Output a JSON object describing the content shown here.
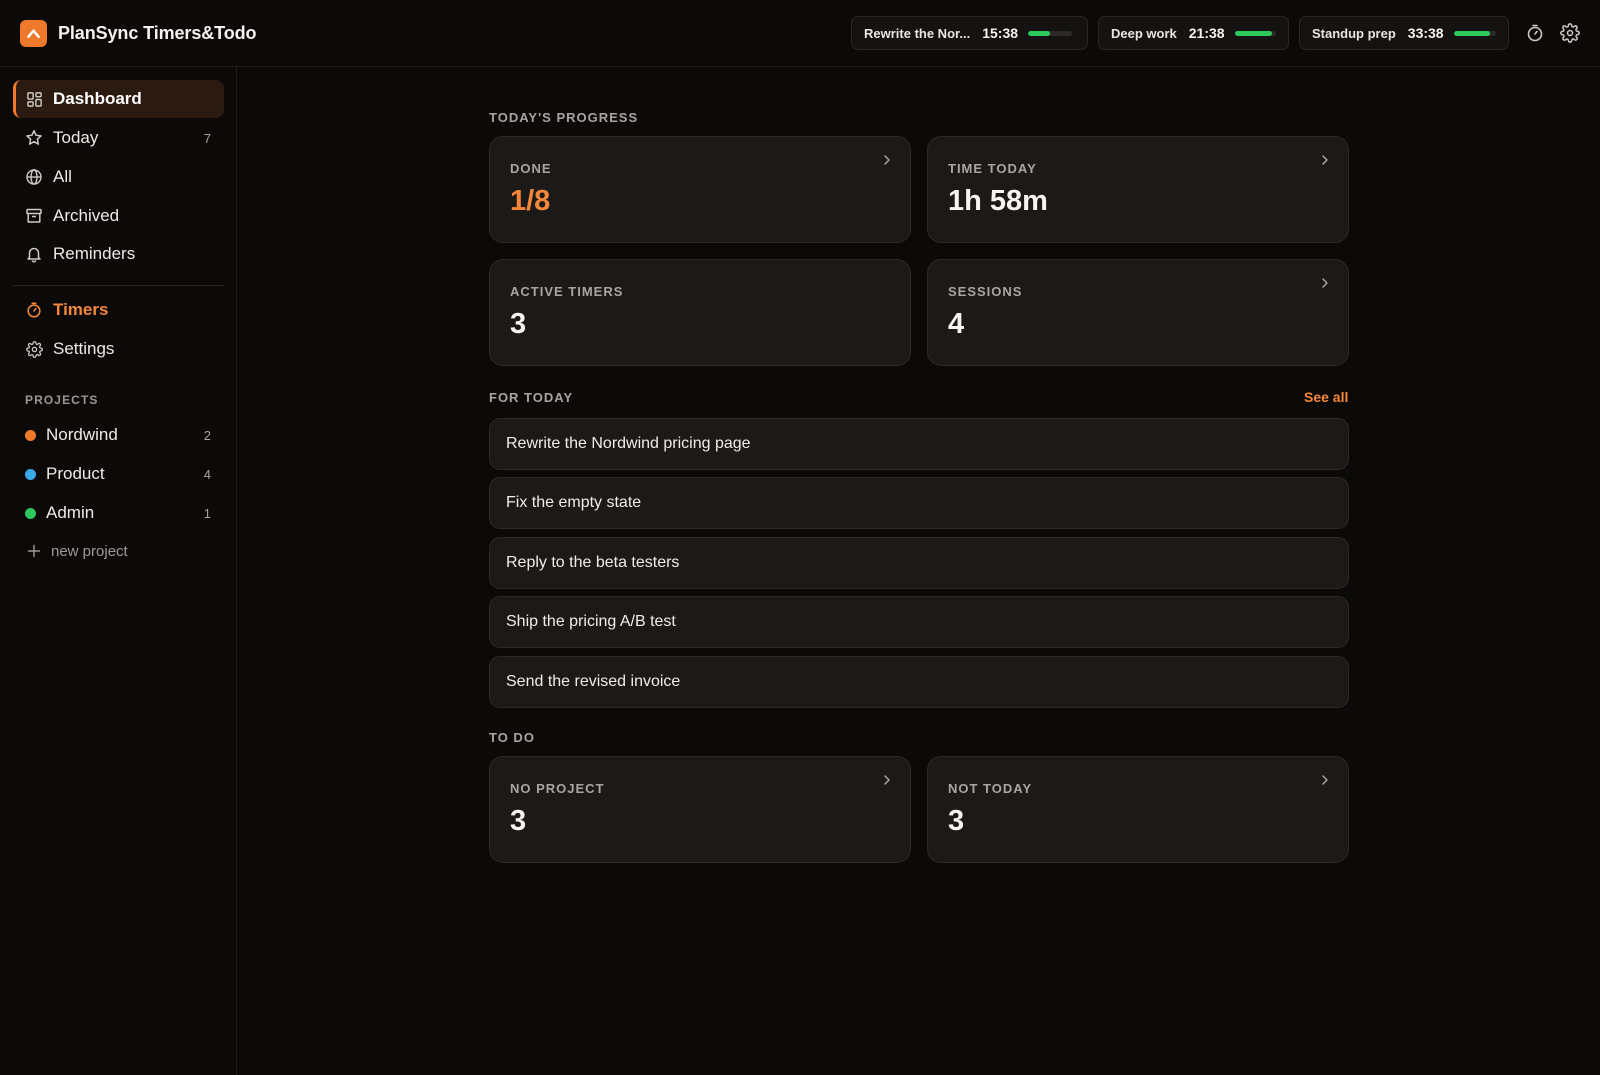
{
  "app": {
    "title": "PlanSync Timers&Todo",
    "accent_color": "#f07a2c",
    "logo_icon": "app-logo-icon"
  },
  "timers": [
    {
      "name": "Rewrite the Nor...",
      "time": "15:38",
      "progress": 0.5
    },
    {
      "name": "Deep work",
      "time": "21:38",
      "progress": 0.9
    },
    {
      "name": "Standup prep",
      "time": "33:38",
      "progress": 0.85
    }
  ],
  "topbar_icons": [
    "stopwatch-icon",
    "gear-icon"
  ],
  "sidebar": {
    "items": [
      {
        "label": "Dashboard",
        "icon": "dashboard-icon",
        "active": true
      },
      {
        "label": "Today",
        "icon": "star-icon",
        "count": "7"
      },
      {
        "label": "All",
        "icon": "globe-icon"
      },
      {
        "label": "Archived",
        "icon": "archive-icon"
      },
      {
        "label": "Reminders",
        "icon": "bell-icon"
      }
    ],
    "secondary": [
      {
        "label": "Timers",
        "icon": "stopwatch-icon",
        "color": "#f5873a"
      },
      {
        "label": "Settings",
        "icon": "gear-icon"
      }
    ],
    "projects_label": "PROJECTS",
    "projects": [
      {
        "label": "Nordwind",
        "count": "2",
        "color": "#f07a2c"
      },
      {
        "label": "Product",
        "count": "4",
        "color": "#3ba8e8"
      },
      {
        "label": "Admin",
        "count": "1",
        "color": "#2ec95c"
      }
    ],
    "new_project": "new project"
  },
  "main": {
    "progress_label": "TODAY'S PROGRESS",
    "stats": [
      {
        "label": "DONE",
        "value": "1/8"
      },
      {
        "label": "TIME TODAY",
        "value": "1h 58m"
      },
      {
        "label": "ACTIVE TIMERS",
        "value": "3"
      },
      {
        "label": "SESSIONS",
        "value": "4"
      }
    ],
    "for_today_label": "FOR TODAY",
    "see_all": "See all",
    "tasks": [
      "Rewrite the Nordwind pricing page",
      "Fix the empty state",
      "Reply to the beta testers",
      "Ship the pricing A/B test",
      "Send the revised invoice"
    ],
    "todo_label": "TO DO",
    "todo_cards": [
      {
        "label": "NO PROJECT",
        "value": "3"
      },
      {
        "label": "NOT TODAY",
        "value": "3"
      }
    ]
  }
}
